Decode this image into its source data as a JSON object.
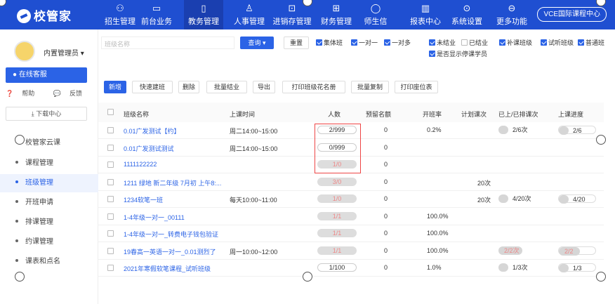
{
  "app": {
    "logo": "校管家",
    "vce": "VCE国际课程中心"
  },
  "nav": [
    {
      "label": "招生管理",
      "icon": "user-plus-icon"
    },
    {
      "label": "前台业务",
      "icon": "monitor-icon"
    },
    {
      "label": "教务管理",
      "icon": "book-icon"
    },
    {
      "label": "人事管理",
      "icon": "person-icon"
    },
    {
      "label": "进销存管理",
      "icon": "box-icon"
    },
    {
      "label": "财务管理",
      "icon": "wallet-icon"
    },
    {
      "label": "师生信",
      "icon": "chat-icon"
    },
    {
      "label": "报表中心",
      "icon": "chart-icon"
    },
    {
      "label": "系统设置",
      "icon": "gear-icon"
    },
    {
      "label": "更多功能",
      "icon": "more-icon"
    }
  ],
  "sidebar": {
    "admin": "内置管理员",
    "kefu": "在线客服",
    "help": "帮助",
    "feedback": "反馈",
    "download": "下载中心",
    "items": [
      "校管家云课",
      "课程管理",
      "班级管理",
      "开班申请",
      "排课管理",
      "约课管理",
      "课表和点名"
    ]
  },
  "filter": {
    "placeholder": "班级名称",
    "search": "查询",
    "reset": "重置",
    "options": [
      {
        "label": "集体班",
        "checked": true
      },
      {
        "label": "一对一",
        "checked": true
      },
      {
        "label": "一对多",
        "checked": true
      },
      {
        "label": "未结业",
        "checked": true
      },
      {
        "label": "已结业",
        "checked": false
      },
      {
        "label": "补课班级",
        "checked": true
      },
      {
        "label": "试听班级",
        "checked": true
      },
      {
        "label": "普通班",
        "checked": true
      },
      {
        "label": "是否显示停课学员",
        "checked": true
      }
    ]
  },
  "toolbar": [
    "新增",
    "快速建班",
    "删除",
    "批量结业",
    "导出",
    "打印班级花名册",
    "批量复制",
    "打印座位表"
  ],
  "table": {
    "headers": [
      "班级名称",
      "上课时间",
      "人数",
      "预留名额",
      "开班率",
      "计划课次",
      "已上/已排课次",
      "上课进度"
    ],
    "rows": [
      {
        "name": "0.01广发测试【约】",
        "time": "周二14:00~15:00",
        "count": "2/999",
        "reserve": "0",
        "rate": "0.2%",
        "plan": "",
        "done": "2/6次",
        "progress": "2/6",
        "done_frac": 0.33,
        "prog_frac": 0.33,
        "gray": false
      },
      {
        "name": "0.01广发测试测试",
        "time": "周二14:00~15:00",
        "count": "0/999",
        "reserve": "0",
        "rate": "",
        "plan": "",
        "done": "",
        "progress": "",
        "done_frac": 0,
        "prog_frac": 0,
        "gray": false
      },
      {
        "name": "1111122222",
        "time": "",
        "count": "1/0",
        "reserve": "0",
        "rate": "",
        "plan": "",
        "done": "",
        "progress": "",
        "done_frac": 0,
        "prog_frac": 0,
        "gray": true
      },
      {
        "name": "1211 绿地 新二年级 7月初 上午8:...",
        "time": "",
        "count": "3/0",
        "reserve": "0",
        "rate": "",
        "plan": "20次",
        "done": "",
        "progress": "",
        "done_frac": 0,
        "prog_frac": 0,
        "gray": true
      },
      {
        "name": "1234软笔一班",
        "time": "每天10:00~11:00",
        "count": "1/0",
        "reserve": "0",
        "rate": "",
        "plan": "20次",
        "done": "4/20次",
        "progress": "4/20",
        "done_frac": 0.2,
        "prog_frac": 0.2,
        "gray": true
      },
      {
        "name": "1-4年级一对一_00111",
        "time": "",
        "count": "1/1",
        "reserve": "0",
        "rate": "100.0%",
        "plan": "",
        "done": "",
        "progress": "",
        "done_frac": 0,
        "prog_frac": 0,
        "gray": true
      },
      {
        "name": "1-4年级一对一_转费电子钱包验证",
        "time": "",
        "count": "1/1",
        "reserve": "0",
        "rate": "100.0%",
        "plan": "",
        "done": "",
        "progress": "",
        "done_frac": 0,
        "prog_frac": 0,
        "gray": true
      },
      {
        "name": "19春高一英语一对一_0.01测烈了",
        "time": "周一10:00~12:00",
        "count": "1/1",
        "reserve": "0",
        "rate": "100.0%",
        "plan": "",
        "done": "2/2次",
        "progress": "2/2",
        "done_frac": 1,
        "prog_frac": 1,
        "gray": true
      },
      {
        "name": "2021年寒假软笔课程_试听班级",
        "time": "",
        "count": "1/100",
        "reserve": "0",
        "rate": "1.0%",
        "plan": "",
        "done": "1/3次",
        "progress": "1/3",
        "done_frac": 0.33,
        "prog_frac": 0.33,
        "gray": false
      }
    ]
  }
}
